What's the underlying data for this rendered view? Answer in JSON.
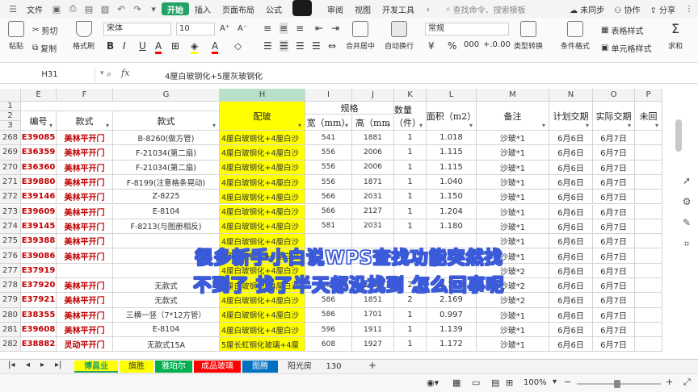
{
  "menu": {
    "file": "文件",
    "tabs": [
      "开始",
      "插入",
      "页面布局",
      "公式",
      "数",
      "审阅",
      "视图",
      "开发工具"
    ],
    "active_tab": "开始",
    "search_placeholder": "查找命令、搜索模板",
    "unsync": "未同步",
    "collab": "协作",
    "share": "分享"
  },
  "ribbon": {
    "paste": "粘贴",
    "cut": "剪切",
    "copy": "复制",
    "format_painter": "格式刷",
    "font_name": "宋体",
    "font_size": "10",
    "merge": "合并居中",
    "wrap": "自动换行",
    "number_format": "常规",
    "type_convert": "类型转换",
    "cond_format": "条件格式",
    "table_style": "表格样式",
    "cell_style": "单元格样式",
    "sum": "求和",
    "bold": "B",
    "italic": "I",
    "underline": "U"
  },
  "formula_bar": {
    "cell_ref": "H31",
    "fx": "fx",
    "content": "4厘白玻钢化+5厘灰玻钢化"
  },
  "columns": [
    "E",
    "F",
    "G",
    "H",
    "I",
    "J",
    "K",
    "L",
    "M",
    "N",
    "O",
    "P"
  ],
  "headers": {
    "spec": "规格",
    "code": "编号",
    "style1": "款式",
    "style2": "款式",
    "glass": "配玻",
    "width": "宽（mm）",
    "height": "高（mm",
    "qty": "数量（件）",
    "area": "面积（m2）",
    "note": "备注",
    "plan_date": "计划交期",
    "actual_date": "实际交期",
    "last": "未回"
  },
  "rows": [
    {
      "n": "268",
      "code": "E39085",
      "style": "美林平开门",
      "model": "B-8260(做方管)",
      "glass": "4厘白玻钢化+4厘白沙",
      "w": "541",
      "h": "1881",
      "qty": "1",
      "area": "1.018",
      "note": "沙玻*1",
      "plan": "6月6日",
      "act": "6月7日"
    },
    {
      "n": "269",
      "code": "E36359",
      "style": "美林平开门",
      "model": "F-21034(第二扇)",
      "glass": "4厘白玻钢化+4厘白沙",
      "w": "556",
      "h": "2006",
      "qty": "1",
      "area": "1.115",
      "note": "沙玻*1",
      "plan": "6月6日",
      "act": "6月7日"
    },
    {
      "n": "270",
      "code": "E36360",
      "style": "美林平开门",
      "model": "F-21034(第二扇)",
      "glass": "4厘白玻钢化+4厘白沙",
      "w": "556",
      "h": "2006",
      "qty": "1",
      "area": "1.115",
      "note": "沙玻*1",
      "plan": "6月6日",
      "act": "6月7日"
    },
    {
      "n": "271",
      "code": "E39880",
      "style": "美林平开门",
      "model": "F-8199(注意格条晃动)",
      "glass": "4厘白玻钢化+4厘白沙",
      "w": "556",
      "h": "1871",
      "qty": "1",
      "area": "1.040",
      "note": "沙玻*1",
      "plan": "6月6日",
      "act": "6月7日"
    },
    {
      "n": "272",
      "code": "E39146",
      "style": "美林平开门",
      "model": "Z-8225",
      "glass": "4厘白玻钢化+4厘白沙",
      "w": "566",
      "h": "2031",
      "qty": "1",
      "area": "1.150",
      "note": "沙玻*1",
      "plan": "6月6日",
      "act": "6月7日"
    },
    {
      "n": "273",
      "code": "E39609",
      "style": "美林平开门",
      "model": "E-8104",
      "glass": "4厘白玻钢化+4厘白沙",
      "w": "566",
      "h": "2127",
      "qty": "1",
      "area": "1.204",
      "note": "沙玻*1",
      "plan": "6月6日",
      "act": "6月7日"
    },
    {
      "n": "274",
      "code": "E39145",
      "style": "美林平开门",
      "model": "F-8213(与图册相反)",
      "glass": "4厘白玻钢化+4厘白沙",
      "w": "581",
      "h": "2031",
      "qty": "1",
      "area": "1.180",
      "note": "沙玻*1",
      "plan": "6月6日",
      "act": "6月7日"
    },
    {
      "n": "275",
      "code": "E39388",
      "style": "美林平开门",
      "model": "",
      "glass": "4厘白玻钢化+4厘白沙",
      "w": "",
      "h": "",
      "qty": "",
      "area": "",
      "note": "沙玻*1",
      "plan": "6月6日",
      "act": "6月7日"
    },
    {
      "n": "276",
      "code": "E39086",
      "style": "美林平开门",
      "model": "",
      "glass": "4厘白玻钢化+4厘白沙",
      "w": "",
      "h": "",
      "qty": "",
      "area": "",
      "note": "沙玻*1",
      "plan": "6月6日",
      "act": "6月7日"
    },
    {
      "n": "277",
      "code": "E37919",
      "style": "",
      "model": "",
      "glass": "4厘白玻钢化+4厘白沙",
      "w": "",
      "h": "",
      "qty": "",
      "area": "",
      "note": "沙玻*2",
      "plan": "6月6日",
      "act": "6月7日"
    },
    {
      "n": "278",
      "code": "E37920",
      "style": "美林平开门",
      "model": "无款式",
      "glass": "4厘白玻钢化+4厘白沙",
      "w": "586",
      "h": "1851",
      "qty": "2",
      "area": "2.169",
      "note": "沙玻*2",
      "plan": "6月6日",
      "act": "6月7日"
    },
    {
      "n": "279",
      "code": "E37921",
      "style": "美林平开门",
      "model": "无款式",
      "glass": "4厘白玻钢化+4厘白沙",
      "w": "586",
      "h": "1851",
      "qty": "2",
      "area": "2.169",
      "note": "沙玻*2",
      "plan": "6月6日",
      "act": "6月7日"
    },
    {
      "n": "280",
      "code": "E38355",
      "style": "美林平开门",
      "model": "三横一竖（7*12方管）",
      "glass": "4厘白玻钢化+4厘白沙",
      "w": "586",
      "h": "1701",
      "qty": "1",
      "area": "0.997",
      "note": "沙玻*1",
      "plan": "6月6日",
      "act": "6月7日"
    },
    {
      "n": "281",
      "code": "E39608",
      "style": "美林平开门",
      "model": "E-8104",
      "glass": "4厘白玻钢化+4厘白沙",
      "w": "596",
      "h": "1911",
      "qty": "1",
      "area": "1.139",
      "note": "沙玻*1",
      "plan": "6月6日",
      "act": "6月7日"
    },
    {
      "n": "282",
      "code": "E38882",
      "style": "灵动平开门",
      "model": "无款式15A",
      "glass": "5厘长虹钢化玻璃+4厘",
      "w": "608",
      "h": "1927",
      "qty": "1",
      "area": "1.172",
      "note": "沙玻*1",
      "plan": "6月6日",
      "act": "6月7日"
    }
  ],
  "sheets": [
    {
      "name": "博昌业",
      "color": "#ffff00",
      "active": true
    },
    {
      "name": "旗胜",
      "color": "#ffff00",
      "active": false
    },
    {
      "name": "雅珀尔",
      "color": "#00b050",
      "active": false
    },
    {
      "name": "成品玻璃",
      "color": "#ff0000",
      "active": false
    },
    {
      "name": "图腾",
      "color": "#0070c0",
      "active": false
    },
    {
      "name": "阳光房",
      "color": "#f3f3f3",
      "active": false
    },
    {
      "name": "130",
      "color": "#f3f3f3",
      "active": false
    }
  ],
  "status": {
    "zoom": "100%"
  },
  "overlay": {
    "line1": "很多新手小白说WPS查找功能突然找",
    "line2": "不到了 找了半天都没找到 怎么回事呢"
  }
}
